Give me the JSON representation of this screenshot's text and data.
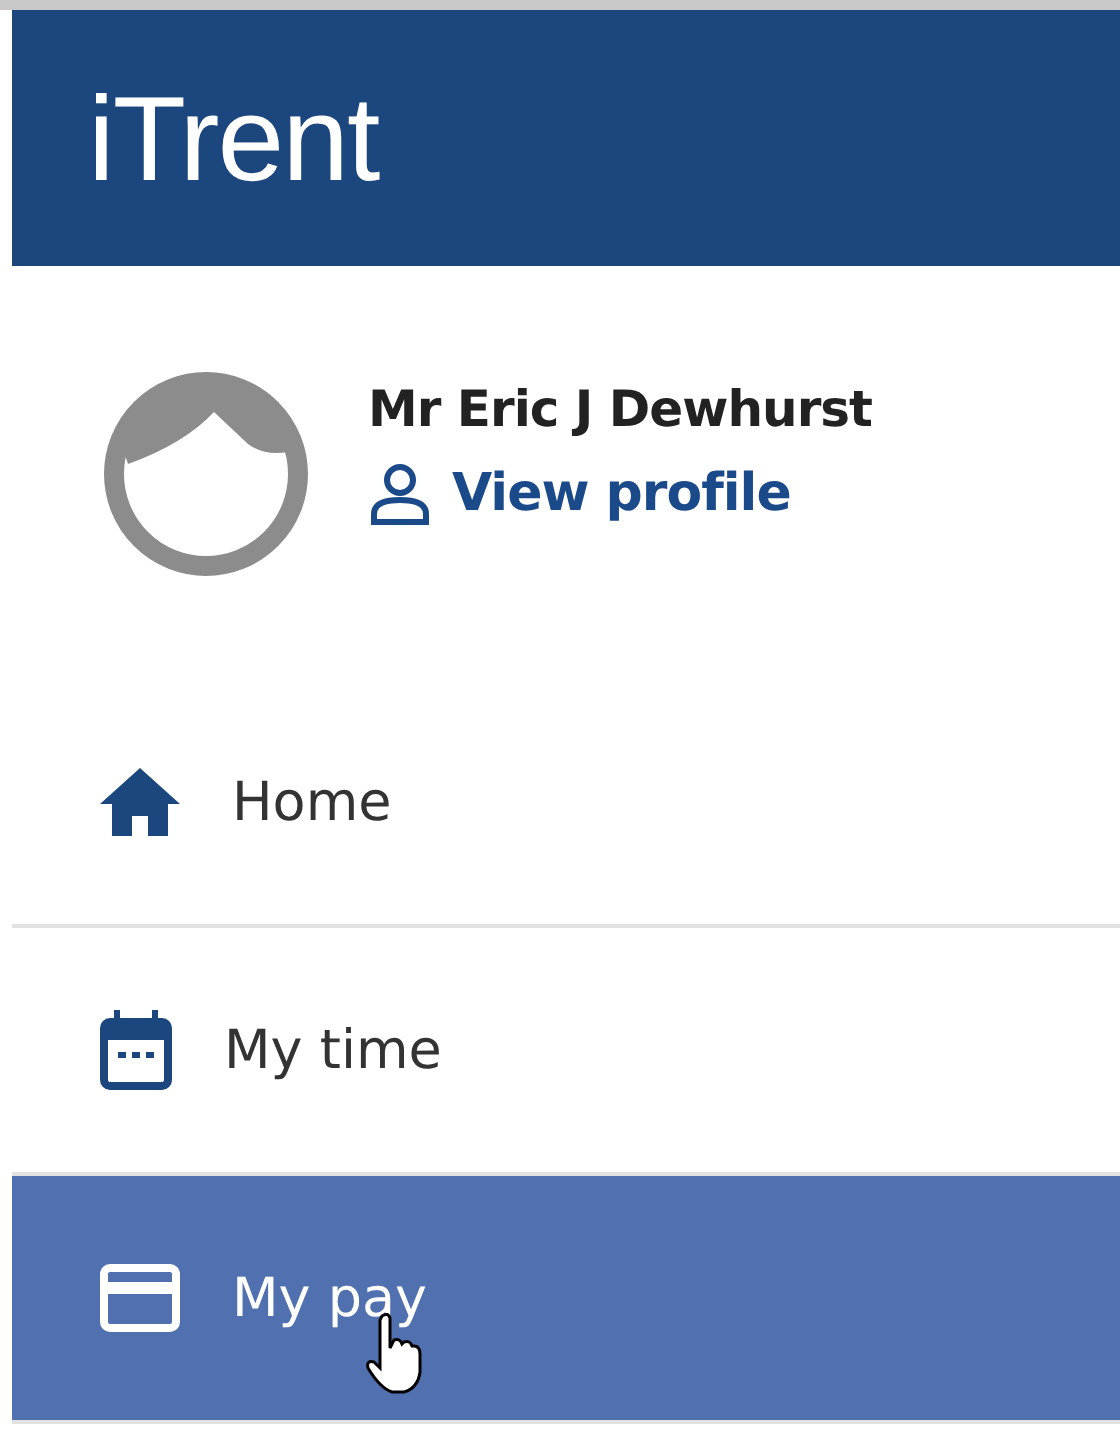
{
  "header": {
    "logo": "iTrent"
  },
  "profile": {
    "name": "Mr Eric J Dewhurst",
    "link": "View profile"
  },
  "nav": [
    {
      "label": "Home",
      "kind": "home",
      "selected": false
    },
    {
      "label": "My time",
      "kind": "calendar",
      "selected": false
    },
    {
      "label": "My pay",
      "kind": "card",
      "selected": true
    }
  ]
}
